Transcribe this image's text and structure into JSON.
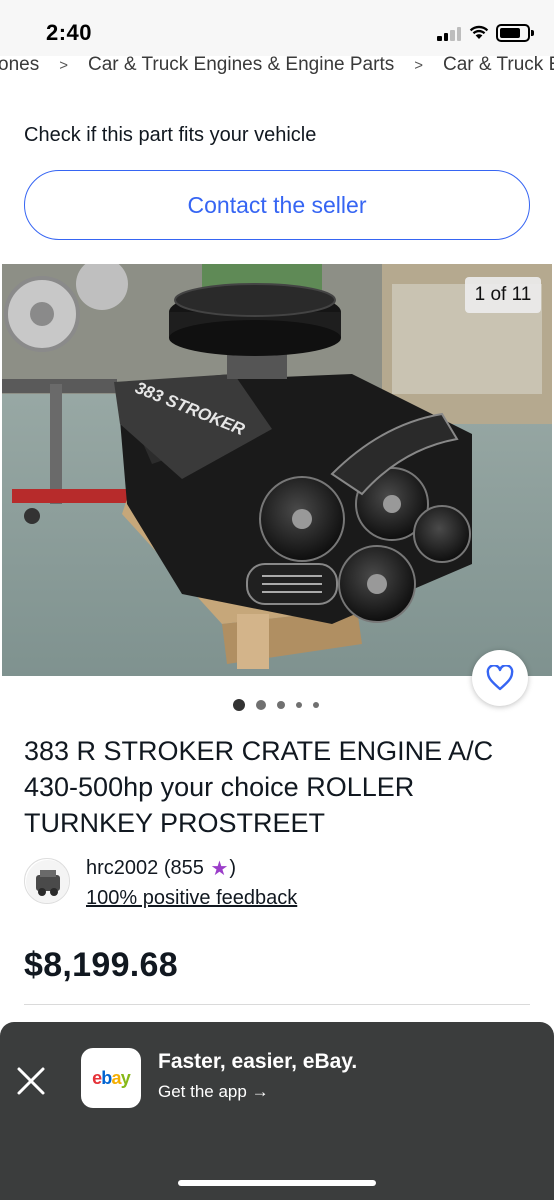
{
  "status_bar": {
    "time": "2:40",
    "icons": [
      "signal-icon",
      "wifi-icon",
      "battery-icon"
    ]
  },
  "breadcrumb": {
    "items": [
      "ones",
      "Car & Truck Engines & Engine Parts",
      "Car & Truck Engi"
    ]
  },
  "fitment": {
    "text": "Check if this part fits your vehicle"
  },
  "contact_button": {
    "label": "Contact the seller"
  },
  "gallery": {
    "counter": "1 of 11",
    "current_index": 1,
    "total": 11,
    "engine_label": "383 STROKER",
    "dots_count": 5,
    "active_dot": 0
  },
  "favorite": {
    "icon": "heart-icon"
  },
  "listing": {
    "title": "383 R STROKER CRATE ENGINE A/C 430-500hp your choice ROLLER TURNKEY PROSTREET",
    "price": "$8,199.68"
  },
  "seller": {
    "name": "hrc2002",
    "score_open": "(855",
    "score_close": ")",
    "feedback": "100% positive feedback"
  },
  "app_banner": {
    "title": "Faster, easier, eBay.",
    "link": "Get the app",
    "arrow": "→",
    "logo_letters": [
      "e",
      "b",
      "a",
      "y"
    ]
  },
  "colors": {
    "accent_blue": "#3665f3",
    "star_purple": "#9b3dc9",
    "banner_bg": "#3b3d3d",
    "ebay_red": "#e53238",
    "ebay_blue": "#0064d2",
    "ebay_yellow": "#f5af02",
    "ebay_green": "#86b817"
  }
}
